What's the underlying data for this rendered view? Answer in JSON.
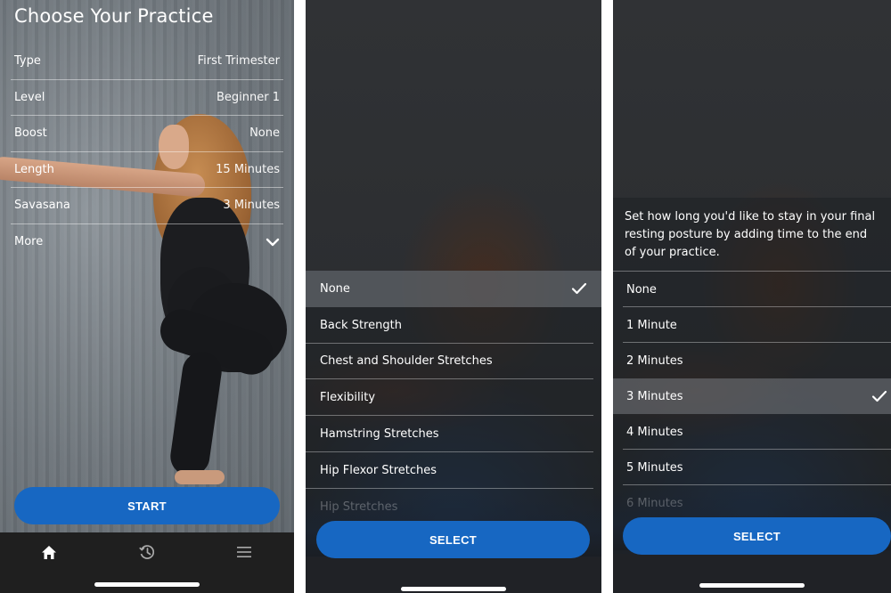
{
  "colors": {
    "accent": "#1767c2",
    "tabbar": "#1f1f1f"
  },
  "practice": {
    "title": "Choose Your Practice",
    "settings": [
      {
        "label": "Type",
        "value": "First Trimester"
      },
      {
        "label": "Level",
        "value": "Beginner 1"
      },
      {
        "label": "Boost",
        "value": "None"
      },
      {
        "label": "Length",
        "value": "15 Minutes"
      },
      {
        "label": "Savasana",
        "value": "3 Minutes"
      },
      {
        "label": "More",
        "value": "",
        "icon": "chevron-down-icon"
      }
    ],
    "start_label": "START",
    "tabs": [
      {
        "name": "home",
        "icon": "home-icon",
        "active": true
      },
      {
        "name": "history",
        "icon": "history-icon",
        "active": false
      },
      {
        "name": "menu",
        "icon": "menu-icon",
        "active": false
      }
    ]
  },
  "boost_picker": {
    "options": [
      {
        "label": "None",
        "selected": true
      },
      {
        "label": "Back Strength",
        "selected": false
      },
      {
        "label": "Chest and Shoulder Stretches",
        "selected": false
      },
      {
        "label": "Flexibility",
        "selected": false
      },
      {
        "label": "Hamstring Stretches",
        "selected": false
      },
      {
        "label": "Hip Flexor Stretches",
        "selected": false
      },
      {
        "label": "Hip Stretches",
        "selected": false
      }
    ],
    "select_label": "SELECT"
  },
  "savasana_picker": {
    "description": "Set how long you'd like to stay in your final resting posture by adding time to the end of your practice.",
    "options": [
      {
        "label": "None",
        "selected": false
      },
      {
        "label": "1 Minute",
        "selected": false
      },
      {
        "label": "2 Minutes",
        "selected": false
      },
      {
        "label": "3 Minutes",
        "selected": true
      },
      {
        "label": "4 Minutes",
        "selected": false
      },
      {
        "label": "5 Minutes",
        "selected": false
      },
      {
        "label": "6 Minutes",
        "selected": false
      }
    ],
    "select_label": "SELECT"
  }
}
